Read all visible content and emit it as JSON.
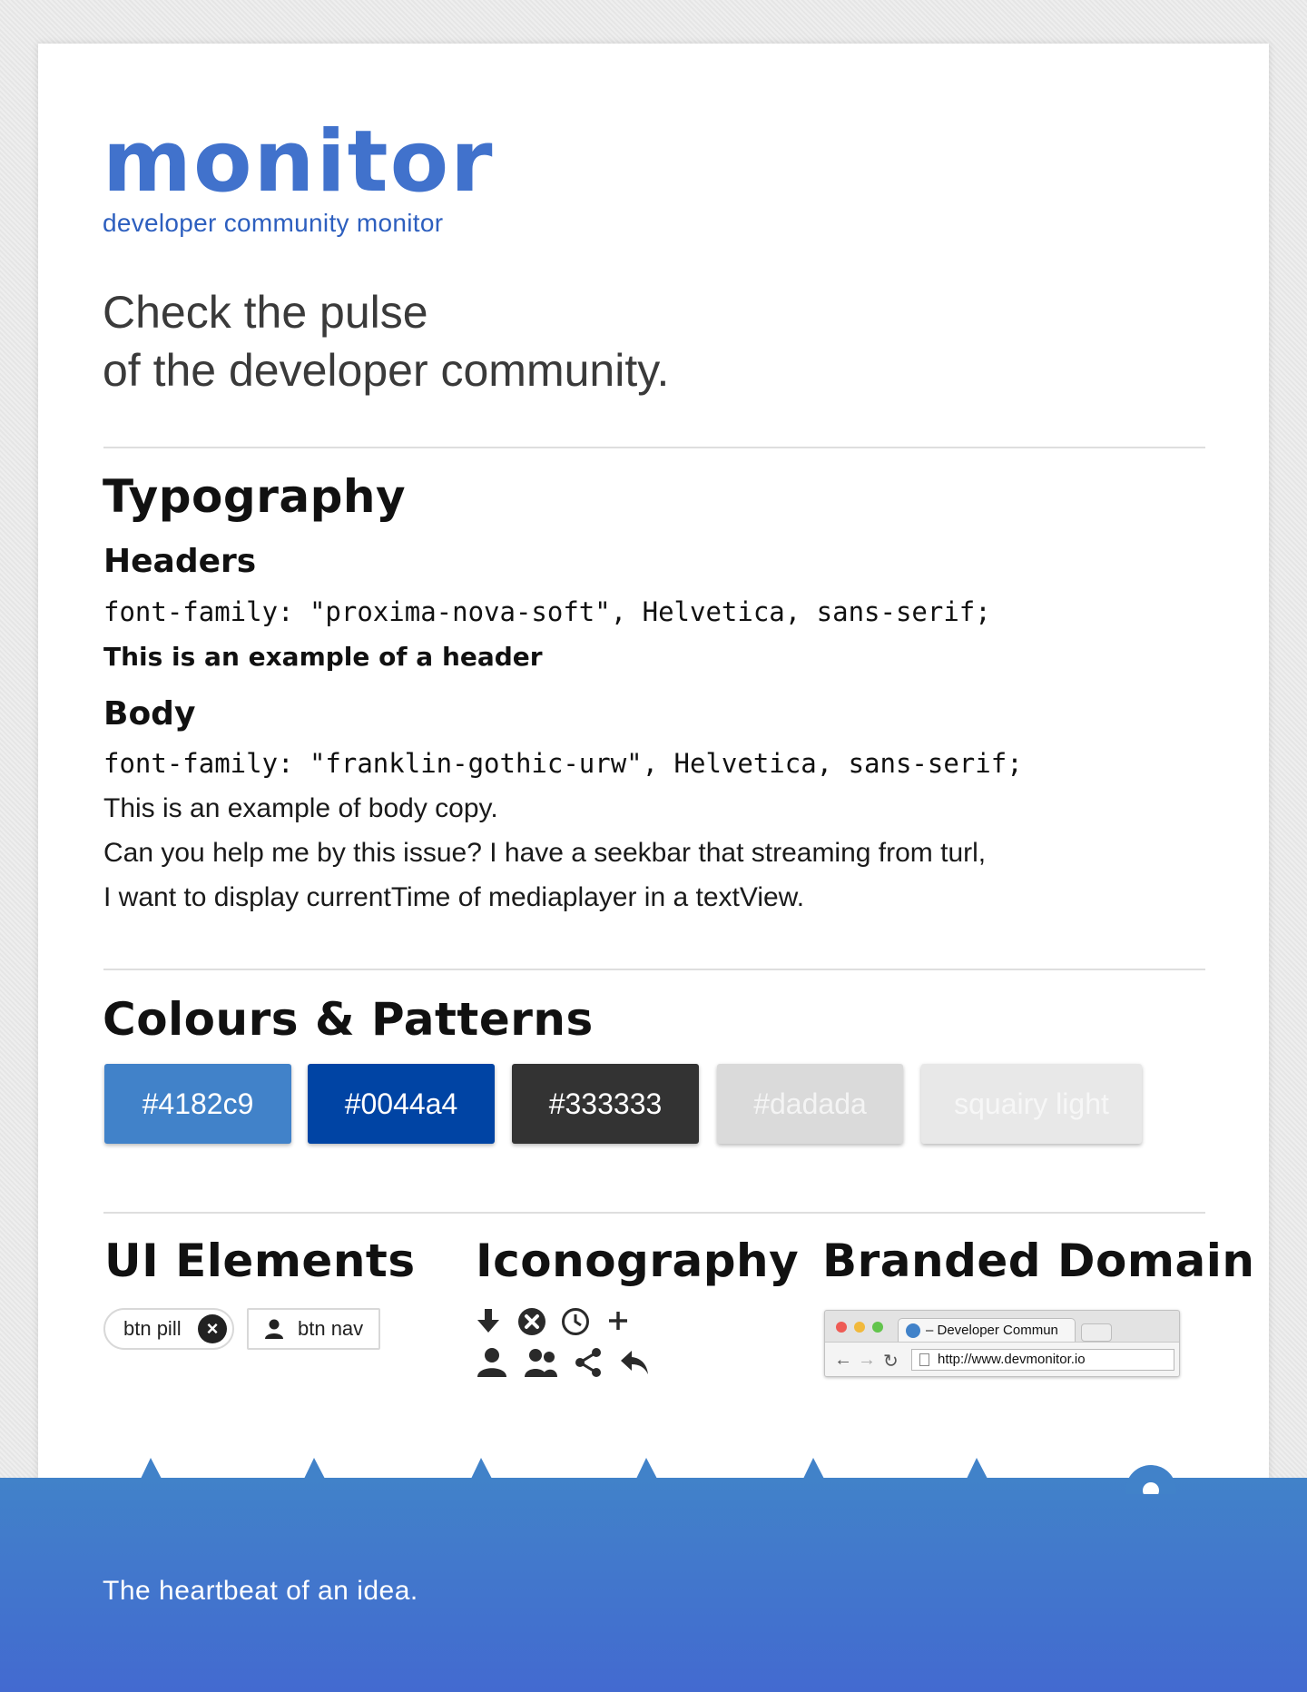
{
  "brand": {
    "logo_word": "monitor",
    "tagline": "developer community monitor"
  },
  "hero": {
    "line1": "Check the pulse",
    "line2": "of the developer community."
  },
  "typography": {
    "title": "Typography",
    "headers_title": "Headers",
    "headers_font": "font-family: \"proxima-nova-soft\", Helvetica, sans-serif;",
    "headers_example": "This is an example of a header",
    "body_title": "Body",
    "body_font": "font-family: \"franklin-gothic-urw\", Helvetica, sans-serif;",
    "body_example_1": "This is an example of body copy.",
    "body_example_2": "Can you help me by this issue? I have a seekbar that streaming from turl,",
    "body_example_3": "I want to display currentTime of mediaplayer in a textView."
  },
  "colours": {
    "title": "Colours & Patterns",
    "swatches": [
      {
        "label": "#4182c9",
        "color": "#4182c9",
        "text_color": "#ffffff"
      },
      {
        "label": "#0044a4",
        "color": "#0044a4",
        "text_color": "#ffffff"
      },
      {
        "label": "#333333",
        "color": "#333333",
        "text_color": "#ffffff"
      },
      {
        "label": "#dadada",
        "color": "#dadada",
        "text_color": "#f4f4f4"
      },
      {
        "label": "squairy light",
        "color": "#e8e8e8",
        "text_color": "#f7f7f7"
      }
    ]
  },
  "ui_elements": {
    "title": "UI Elements",
    "pill_label": "btn pill",
    "nav_label": "btn nav"
  },
  "iconography": {
    "title": "Iconography",
    "icons": [
      "download-icon",
      "close-circle-icon",
      "clock-icon",
      "plus-icon",
      "user-icon",
      "users-icon",
      "share-icon",
      "reply-icon"
    ]
  },
  "branded_domain": {
    "title": "Branded Domain",
    "tab_title": "– Developer Commun",
    "url": "http://www.devmonitor.io"
  },
  "footer": {
    "text": "The heartbeat of an idea."
  }
}
